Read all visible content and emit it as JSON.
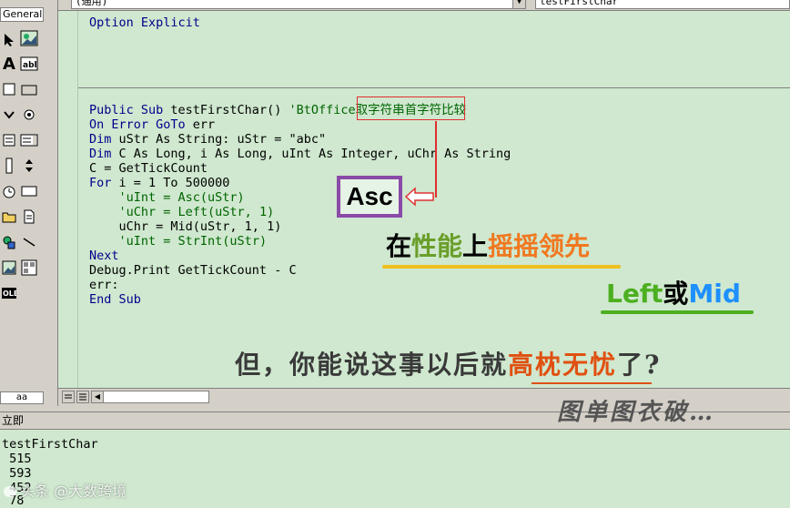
{
  "toolbox": {
    "title": "General",
    "tab_label": "aa",
    "tools": [
      "pointer-icon",
      "image-icon",
      "label-icon",
      "textbox-icon",
      "frame-icon",
      "commandbutton-icon",
      "checkbox-icon",
      "optionbutton-icon",
      "combobox-icon",
      "listbox-icon",
      "scrollbar-icon",
      "spinbutton-icon",
      "timer-icon",
      "textfield-icon",
      "folder-icon",
      "file-icon",
      "shape-icon",
      "line-icon",
      "picture-icon",
      "data-icon",
      "ole-icon"
    ]
  },
  "code_window": {
    "object_combo": "(通用)",
    "procedure_combo": "testFirstChar",
    "option_line": "Option Explicit",
    "lines": [
      {
        "kw": "Public Sub ",
        "text": "testFirstChar() ",
        "comment": "'BtOffice取字符串首字符比较"
      },
      {
        "kw": "On Error GoTo ",
        "text": "err"
      },
      {
        "kw": "Dim ",
        "text": "uStr As String: uStr = \"abc\""
      },
      {
        "kw": "Dim ",
        "text": "C As Long, i As Long, uInt As Integer, uChr As String"
      },
      {
        "kw": "",
        "text": "C = GetTickCount"
      },
      {
        "kw": "For ",
        "text": "i = 1 To 500000"
      },
      {
        "kw": "",
        "text": "    ",
        "comment": "'uInt = Asc(uStr)"
      },
      {
        "kw": "",
        "text": "    ",
        "comment": "'uChr = Left(uStr, 1)"
      },
      {
        "kw": "",
        "text": "    uChr = Mid(uStr, 1, 1)"
      },
      {
        "kw": "",
        "text": "    ",
        "comment": "'uInt = StrInt(uStr)"
      },
      {
        "kw": "Next",
        "text": ""
      },
      {
        "kw": "",
        "text": "Debug.Print GetTickCount - C"
      },
      {
        "kw": "",
        "text": "err:"
      },
      {
        "kw": "End Sub",
        "text": ""
      }
    ]
  },
  "immediate_window": {
    "title": "立即",
    "lines": [
      "testFirstChar",
      " 515",
      " 593",
      " 452",
      " 78"
    ]
  },
  "annotations": {
    "asc_label": "Asc",
    "caption_performance_a": "在",
    "caption_performance_b": "性能",
    "caption_performance_c": "上",
    "caption_performance_d": "摇摇领先",
    "left_label": "Left",
    "or_label": "或",
    "mid_label": "Mid",
    "bottom_caption_a": "但，你能说这事以后就",
    "bottom_caption_hl": "高枕无忧",
    "bottom_caption_b": "了?",
    "signature": "图单图衣破…",
    "watermark": "头条 @大数跨境"
  },
  "colors": {
    "code_bg": "#cfe8cf",
    "keyword": "#00008b",
    "comment": "#006400",
    "highlight_red": "#e03030",
    "asc_border": "#8a4aa8",
    "green_accent": "#4caf20",
    "blue_accent": "#1e90ff",
    "orange_accent": "#f07820"
  }
}
